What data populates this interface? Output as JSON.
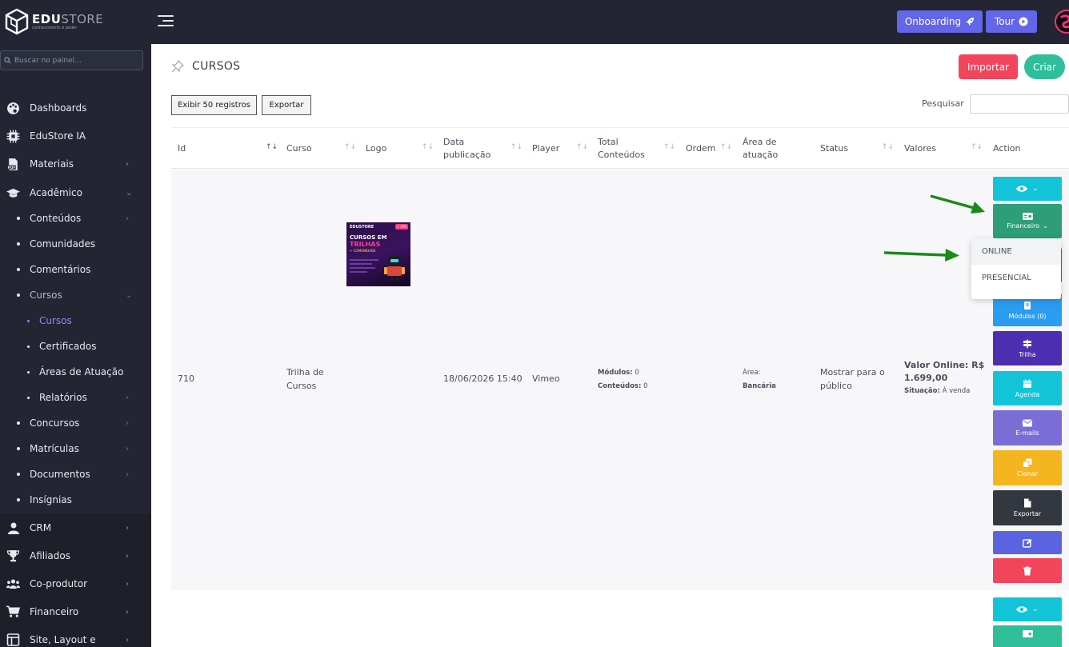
{
  "brand": {
    "name_bold": "EDU",
    "name_light": "STORE",
    "tagline": "conhecimento é poder"
  },
  "search": {
    "placeholder": "Buscar no painel..."
  },
  "sidebar": {
    "items": [
      {
        "label": "Dashboards",
        "icon": "palette-icon"
      },
      {
        "label": "EduStore IA",
        "icon": "chip-icon"
      },
      {
        "label": "Materiais",
        "icon": "pdf-icon"
      },
      {
        "label": "Acadêmico",
        "icon": "graduation-cap-icon"
      }
    ],
    "academic_sub": [
      {
        "label": "Conteúdos"
      },
      {
        "label": "Comunidades"
      },
      {
        "label": "Comentários"
      },
      {
        "label": "Cursos"
      }
    ],
    "courses_sub": [
      {
        "label": "Cursos"
      },
      {
        "label": "Certificados"
      },
      {
        "label": "Áreas de Atuação"
      },
      {
        "label": "Relatórios"
      }
    ],
    "academic_sub2": [
      {
        "label": "Concursos"
      },
      {
        "label": "Matrículas"
      },
      {
        "label": "Documentos"
      },
      {
        "label": "Insígnias"
      }
    ],
    "lower": [
      {
        "label": "CRM",
        "icon": "user-icon"
      },
      {
        "label": "Afiliados",
        "icon": "trophy-icon"
      },
      {
        "label": "Co-produtor",
        "icon": "users-icon"
      },
      {
        "label": "Financeiro",
        "icon": "cart-icon"
      },
      {
        "label": "Site, Layout e",
        "icon": "layout-icon"
      }
    ]
  },
  "topbar": {
    "onboarding_label": "Onboarding",
    "tour_label": "Tour"
  },
  "page": {
    "title": "CURSOS",
    "importar_label": "Importar",
    "criar_label": "Criar",
    "exibir_label": "Exibir 50 registros",
    "exportar_label": "Exportar",
    "search_label": "Pesquisar"
  },
  "table": {
    "headers": {
      "id": "Id",
      "curso": "Curso",
      "logo": "Logo",
      "data_l1": "Data",
      "data_l2": "publicação",
      "player": "Player",
      "total_l1": "Total",
      "total_l2": "Conteúdos",
      "ordem": "Ordem",
      "area_l1": "Área de",
      "area_l2": "atuação",
      "status": "Status",
      "valores": "Valores",
      "action": "Action"
    },
    "row": {
      "id": "710",
      "curso_l1": "Trilha de",
      "curso_l2": "Cursos",
      "data": "18/06/2026 15:40",
      "player": "Vimeo",
      "modulos_label": "Módulos:",
      "modulos_value": "0",
      "conteudos_label": "Conteúdos:",
      "conteudos_value": "0",
      "area_label": "Área:",
      "area_value": "Bancária",
      "status_l1": "Mostrar para o",
      "status_l2": "público",
      "valor_l1": "Valor Online: R$",
      "valor_l2": "1.699,00",
      "situacao_label": "Situação:",
      "situacao_value": "À venda"
    },
    "thumb": {
      "brand": "EDUSTORE",
      "badge": "+ 2PR",
      "title": "CURSOS EM",
      "sub": "TRILHAS",
      "chip": "+ COMUNIDADE"
    }
  },
  "actions": {
    "financeiro": "Financeiro",
    "modulos": "Módulos (0)",
    "trilha": "Trilha",
    "agenda": "Agenda",
    "emails": "E-mails",
    "clonar": "Clonar",
    "exportar": "Exportar"
  },
  "dropdown": {
    "items": [
      "ONLINE",
      "PRESENCIAL"
    ]
  },
  "colors": {
    "sidebar_bg": "#232533",
    "accent": "#6366e8",
    "active_link": "#8e8cf5",
    "danger": "#f2445b",
    "success": "#2ebf9a",
    "arrow": "#1a8a1a"
  }
}
